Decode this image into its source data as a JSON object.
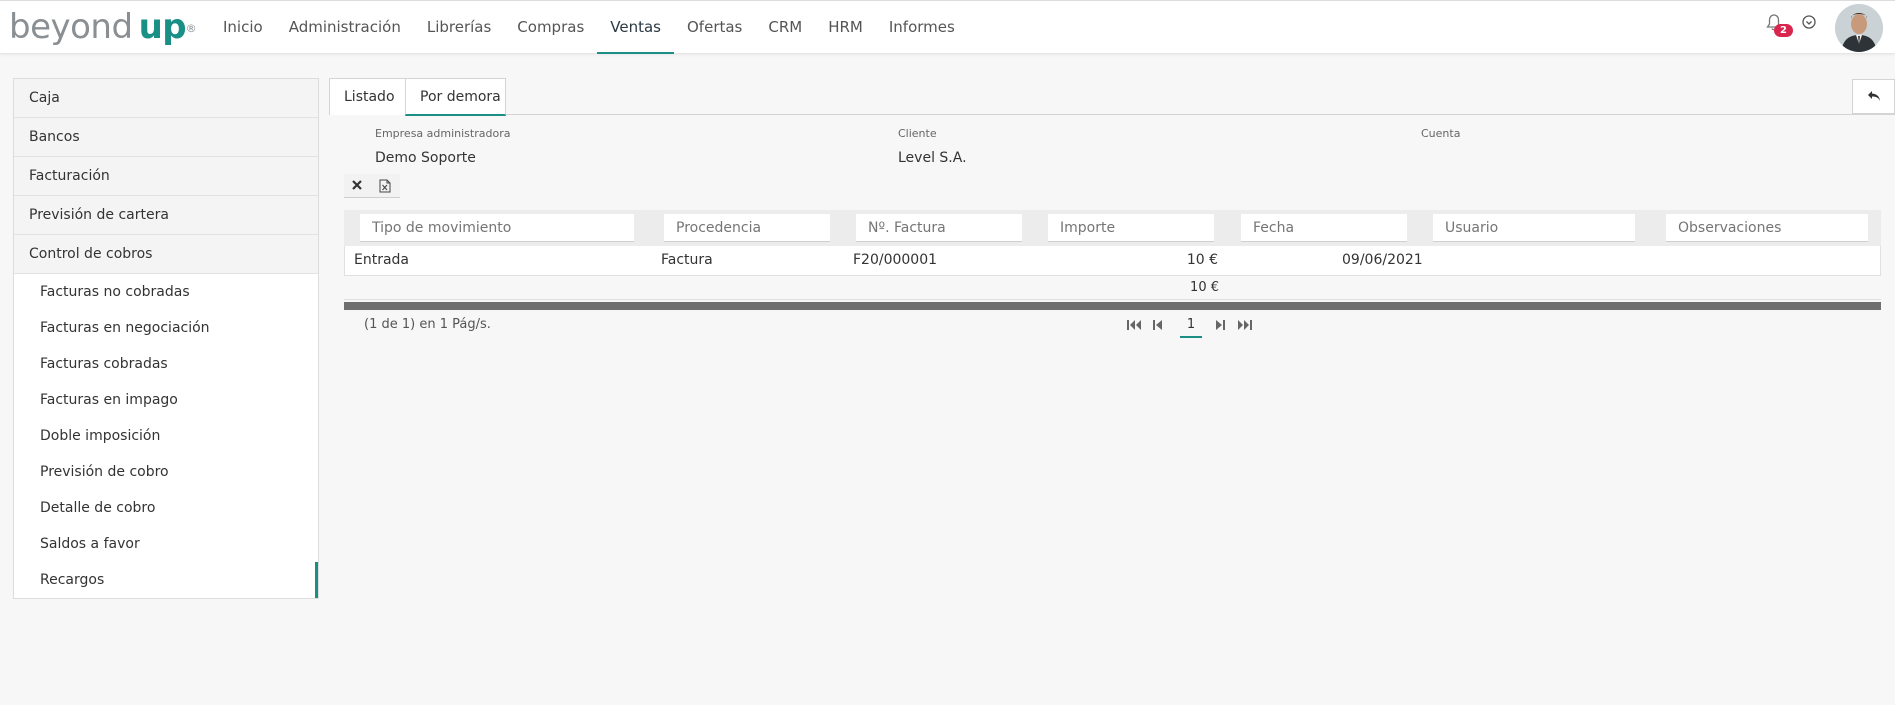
{
  "header": {
    "logo_word1": "beyond",
    "logo_word2": "up",
    "logo_reg": "®",
    "nav": [
      {
        "label": "Inicio"
      },
      {
        "label": "Administración"
      },
      {
        "label": "Librerías"
      },
      {
        "label": "Compras"
      },
      {
        "label": "Ventas",
        "active": true
      },
      {
        "label": "Ofertas"
      },
      {
        "label": "CRM"
      },
      {
        "label": "HRM"
      },
      {
        "label": "Informes"
      }
    ],
    "notification_count": "2",
    "icons": {
      "notifications": "bell-icon",
      "help": "help-circle-icon",
      "user": "avatar"
    }
  },
  "sidebar": {
    "groups": [
      {
        "label": "Caja"
      },
      {
        "label": "Bancos"
      },
      {
        "label": "Facturación"
      },
      {
        "label": "Previsión de cartera"
      },
      {
        "label": "Control de cobros"
      }
    ],
    "subitems": [
      {
        "label": "Facturas no cobradas"
      },
      {
        "label": "Facturas en negociación"
      },
      {
        "label": "Facturas cobradas"
      },
      {
        "label": "Facturas en impago"
      },
      {
        "label": "Doble imposición"
      },
      {
        "label": "Previsión de cobro"
      },
      {
        "label": "Detalle de cobro"
      },
      {
        "label": "Saldos a favor"
      },
      {
        "label": "Recargos",
        "active": true
      }
    ]
  },
  "tabs": [
    {
      "label": "Listado"
    },
    {
      "label": "Por demora",
      "active": true
    }
  ],
  "filters": {
    "empresa_label": "Empresa administradora",
    "empresa_value": "Demo Soporte",
    "cliente_label": "Cliente",
    "cliente_value": "Level S.A.",
    "cuenta_label": "Cuenta",
    "cuenta_value": ""
  },
  "toolbar": {
    "icons": [
      "close-icon",
      "excel-export-icon"
    ]
  },
  "grid": {
    "column_placeholders": [
      "Tipo de movimiento",
      "Procedencia",
      "Nº. Factura",
      "Importe",
      "Fecha",
      "Usuario",
      "Observaciones"
    ],
    "rows": [
      {
        "tipo": "Entrada",
        "procedencia": "Factura",
        "factura": "F20/000001",
        "importe": "10 €",
        "fecha": "09/06/2021",
        "usuario": "",
        "observaciones": ""
      }
    ],
    "total_importe": "10 €"
  },
  "pager": {
    "info": "(1 de 1) en 1 Pág/s.",
    "current_page": "1"
  },
  "colors": {
    "accent": "#1a8f85",
    "badge": "#d8264e"
  }
}
